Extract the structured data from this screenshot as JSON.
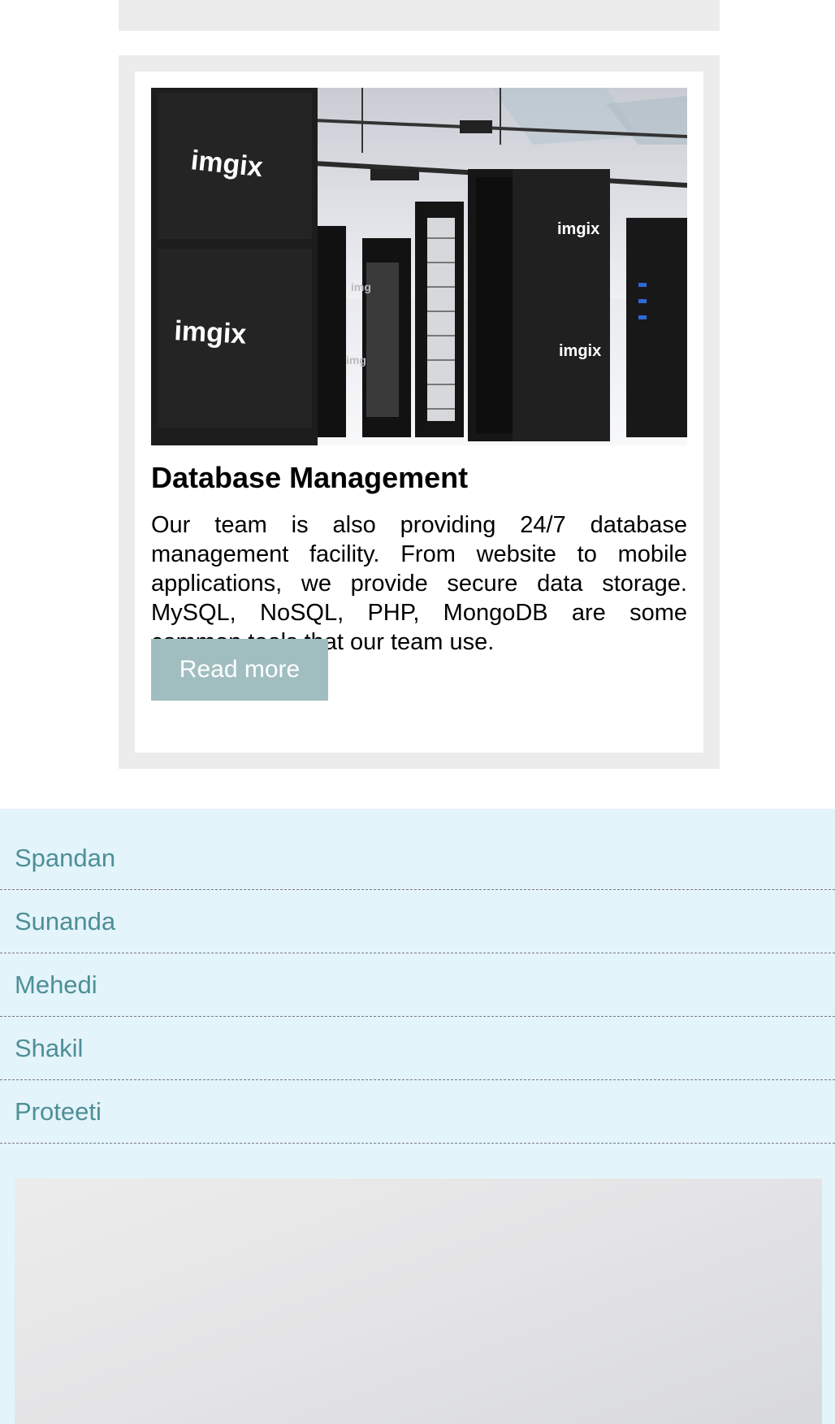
{
  "card": {
    "title": "Database Management",
    "text": "Our team is also providing 24/7 database management facility. From website to mobile applications, we provide secure data storage. MySQL, NoSQL, PHP, MongoDB are some common tools that our team use.",
    "button_label": "Read more",
    "image_brand": "imgix"
  },
  "team": {
    "members": [
      "Spandan",
      "Sunanda",
      "Mehedi",
      "Shakil",
      "Proteeti"
    ]
  },
  "colors": {
    "card_border": "#ececec",
    "button_bg": "#a0bec0",
    "footer_bg": "#e4f4fb",
    "member_text": "#4e8f96"
  }
}
